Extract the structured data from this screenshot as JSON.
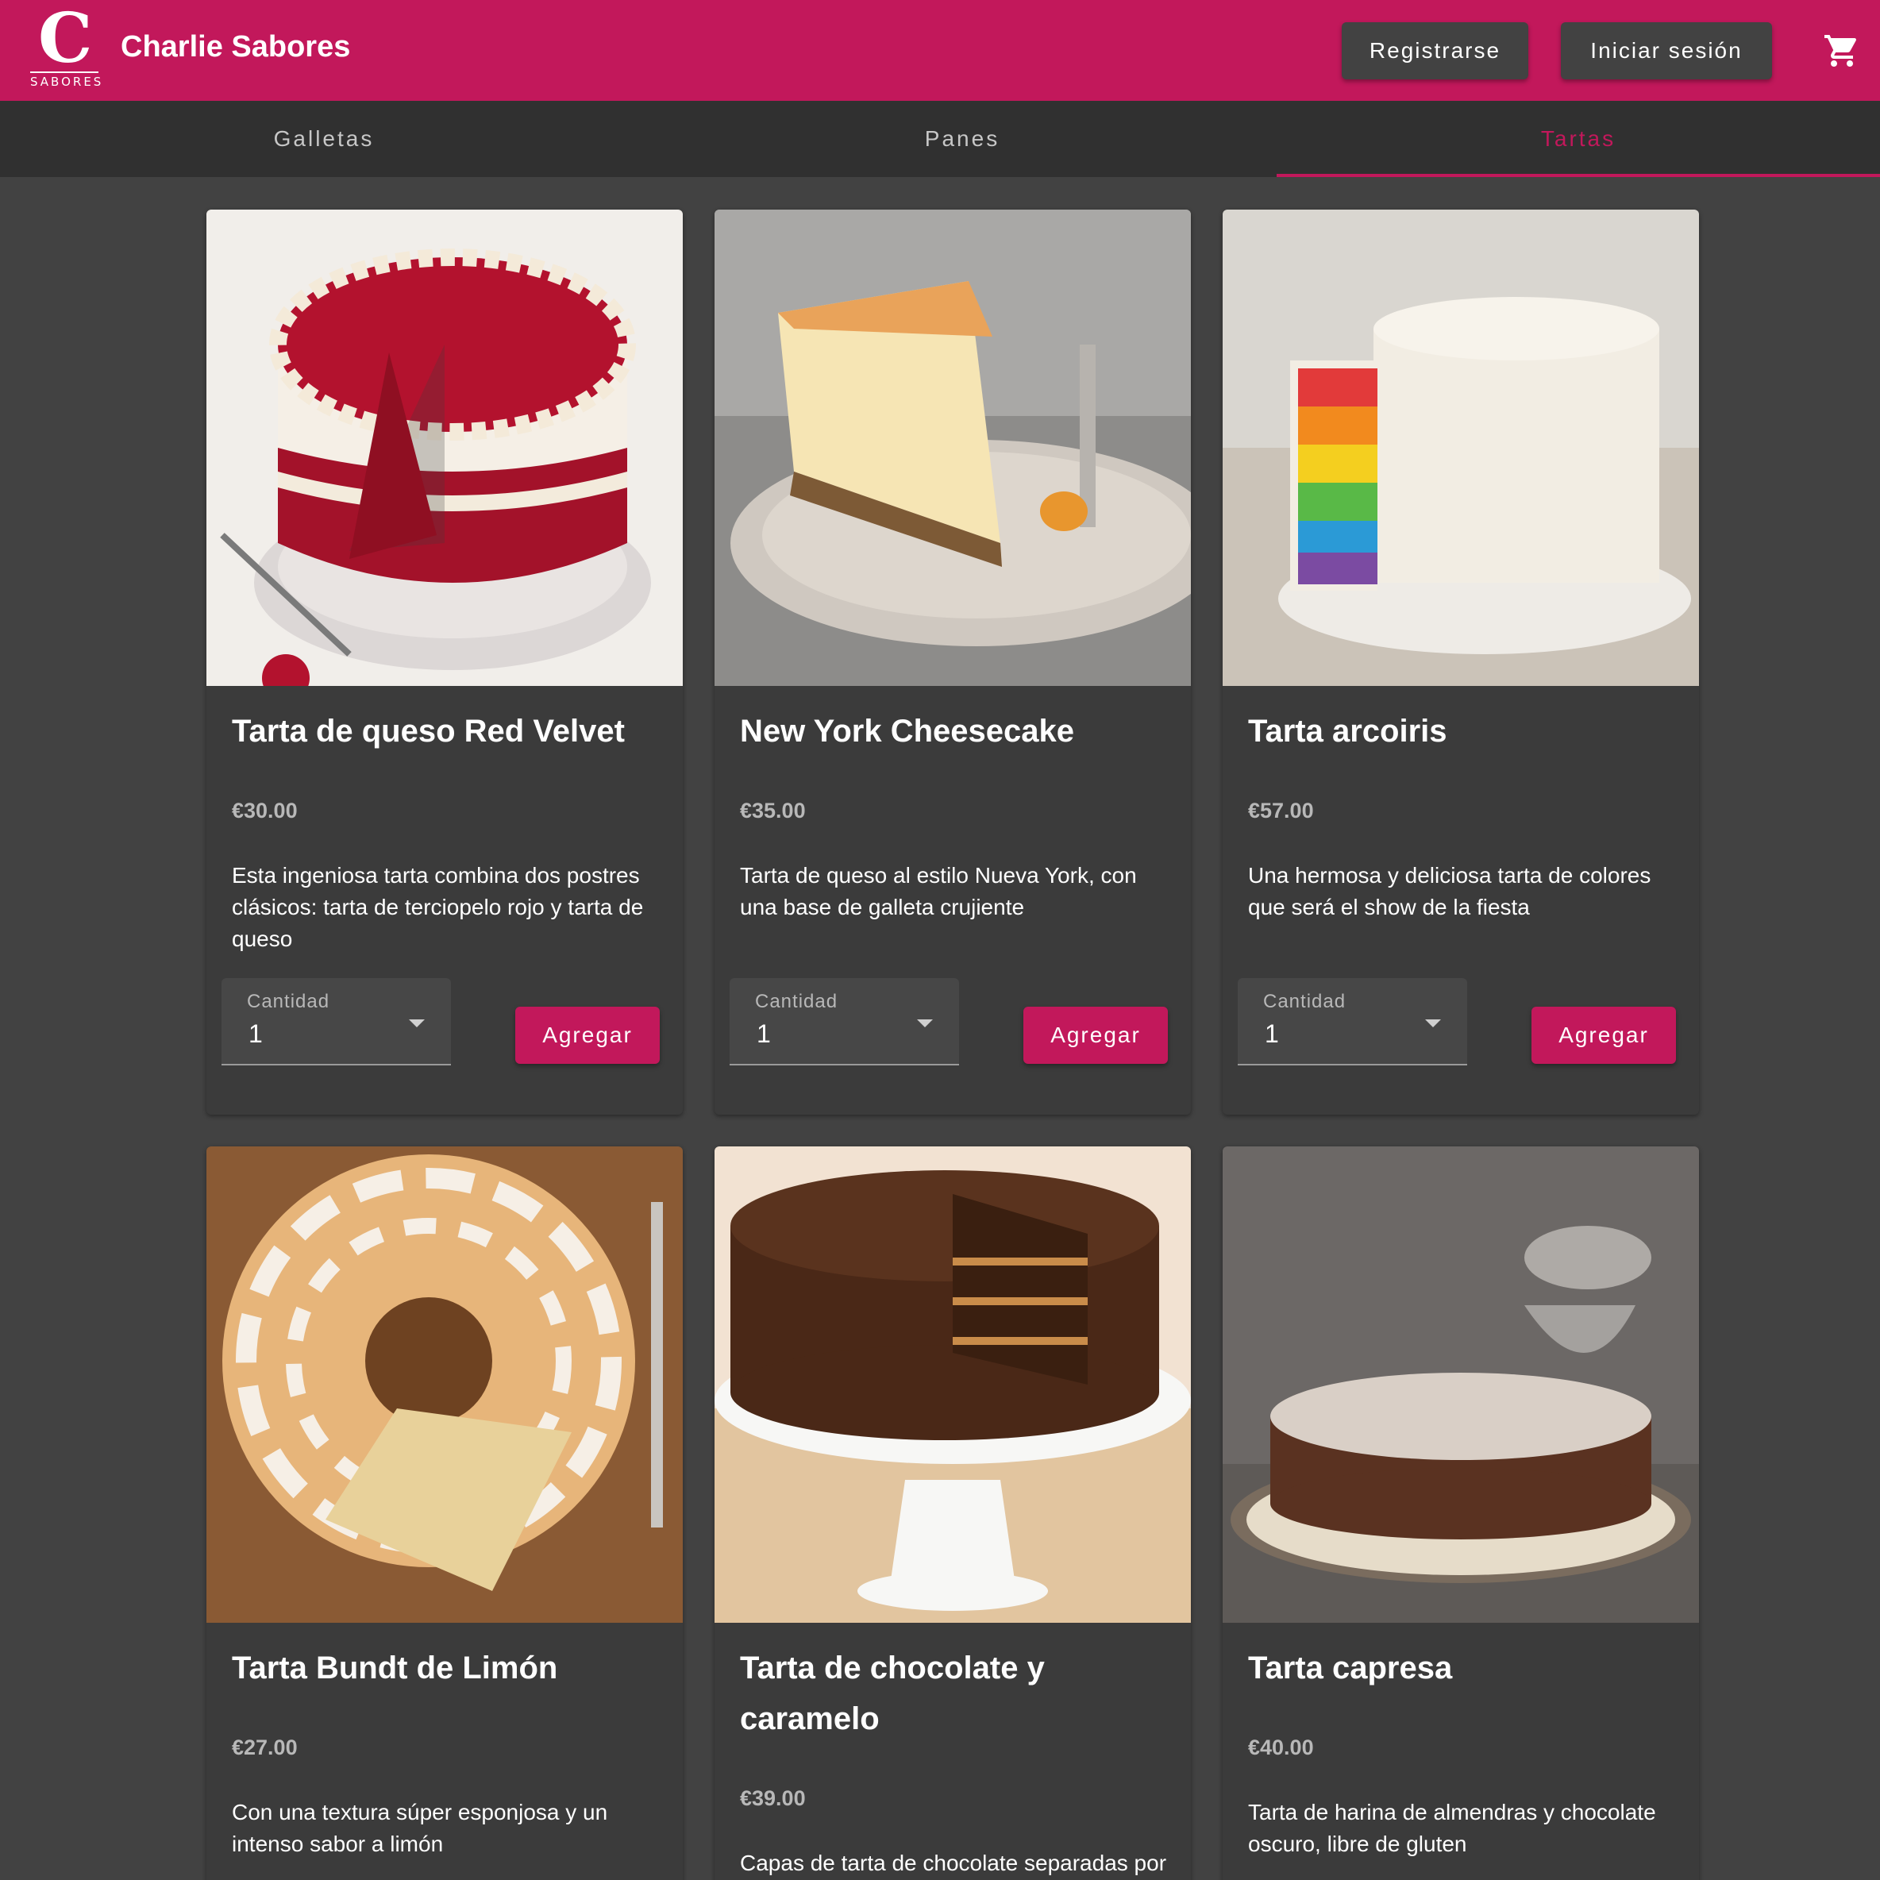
{
  "header": {
    "logo_letter": "C",
    "logo_word": "SABORES",
    "brand": "Charlie Sabores",
    "register_label": "Registrarse",
    "login_label": "Iniciar sesión",
    "cart_icon": "shopping-cart-icon"
  },
  "tabs": [
    {
      "label": "Galletas",
      "active": false
    },
    {
      "label": "Panes",
      "active": false
    },
    {
      "label": "Tartas",
      "active": true
    }
  ],
  "colors": {
    "primary": "#c2185b",
    "appbar_button": "#424242",
    "background": "#303030",
    "card": "#3b3b3b"
  },
  "products": [
    {
      "name": "Tarta de queso Red Velvet",
      "price": "€30.00",
      "description": "Esta ingeniosa tarta combina dos postres clásicos: tarta de terciopelo rojo y tarta de queso",
      "quantity_label": "Cantidad",
      "quantity": "1",
      "add_label": "Agregar",
      "image": "red-velvet-cheesecake-photo"
    },
    {
      "name": "New York Cheesecake",
      "price": "€35.00",
      "description": "Tarta de queso al estilo Nueva York, con una base de galleta crujiente",
      "quantity_label": "Cantidad",
      "quantity": "1",
      "add_label": "Agregar",
      "image": "new-york-cheesecake-photo"
    },
    {
      "name": "Tarta arcoiris",
      "price": "€57.00",
      "description": "Una hermosa y deliciosa tarta de colores que será el show de la fiesta",
      "quantity_label": "Cantidad",
      "quantity": "1",
      "add_label": "Agregar",
      "image": "rainbow-cake-photo"
    },
    {
      "name": "Tarta Bundt de Limón",
      "price": "€27.00",
      "description": "Con una textura súper esponjosa y un intenso sabor a limón",
      "image": "lemon-bundt-cake-photo"
    },
    {
      "name": "Tarta de chocolate y caramelo",
      "price": "€39.00",
      "description": "Capas de tarta de chocolate separadas por un cremoso caramelo",
      "image": "chocolate-caramel-cake-photo"
    },
    {
      "name": "Tarta capresa",
      "price": "€40.00",
      "description": "Tarta de harina de almendras y chocolate oscuro, libre de gluten",
      "image": "torta-caprese-photo"
    }
  ]
}
